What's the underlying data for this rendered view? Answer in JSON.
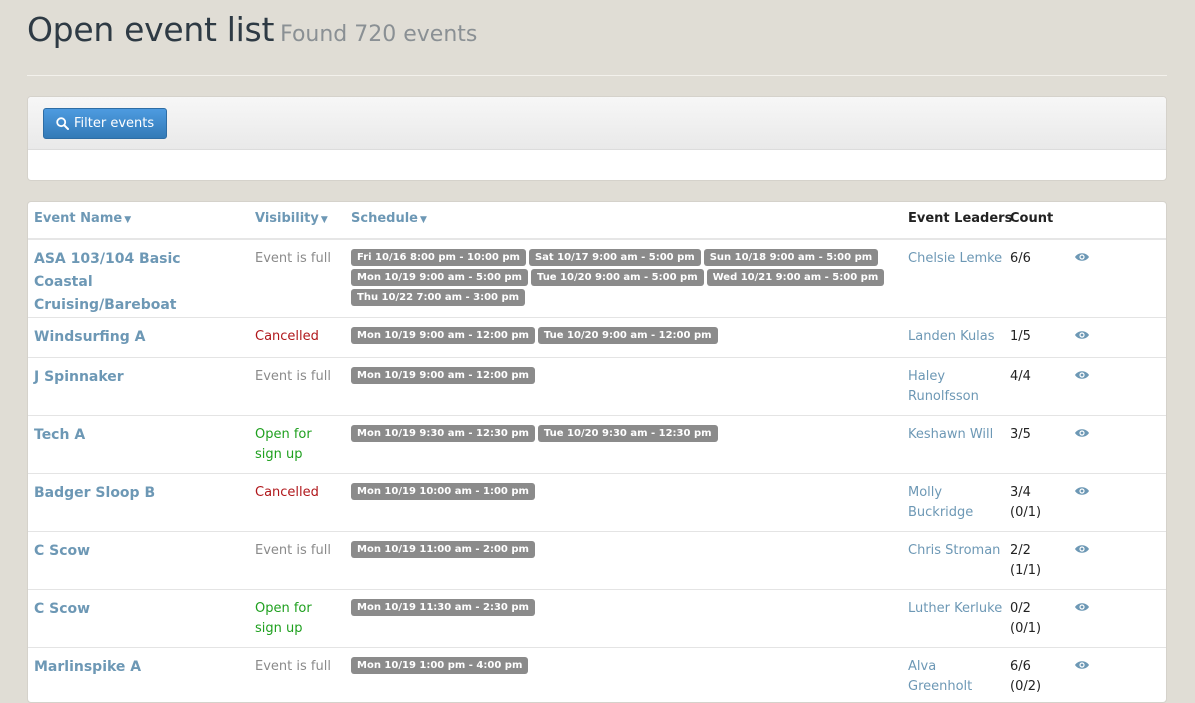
{
  "page": {
    "title": "Open event list",
    "subtitle": "Found 720 events"
  },
  "filter": {
    "button_label": "Filter events",
    "icon": "search-icon"
  },
  "table": {
    "columns": {
      "name": "Event Name",
      "visibility": "Visibility",
      "schedule": "Schedule",
      "leaders": "Event Leaders",
      "count": "Count"
    },
    "rows": [
      {
        "name": "ASA 103/104 Basic Coastal Cruising/Bareboat",
        "visibility": "Event is full",
        "status": "full",
        "schedule": [
          "Fri 10/16 8:00 pm - 10:00 pm",
          "Sat 10/17 9:00 am - 5:00 pm",
          "Sun 10/18 9:00 am - 5:00 pm",
          "Mon 10/19 9:00 am - 5:00 pm",
          "Tue 10/20 9:00 am - 5:00 pm",
          "Wed 10/21 9:00 am - 5:00 pm",
          "Thu 10/22 7:00 am - 3:00 pm"
        ],
        "leaders": "Chelsie Lemke",
        "count": "6/6"
      },
      {
        "name": "Windsurfing A",
        "visibility": "Cancelled",
        "status": "cancelled",
        "schedule": [
          "Mon 10/19 9:00 am - 12:00 pm",
          "Tue 10/20 9:00 am - 12:00 pm"
        ],
        "leaders": "Landen Kulas",
        "count": "1/5"
      },
      {
        "name": "J Spinnaker",
        "visibility": "Event is full",
        "status": "full",
        "schedule": [
          "Mon 10/19 9:00 am - 12:00 pm"
        ],
        "leaders": "Haley Runolfsson",
        "count": "4/4"
      },
      {
        "name": "Tech A",
        "visibility": "Open for sign up",
        "status": "open",
        "schedule": [
          "Mon 10/19 9:30 am - 12:30 pm",
          "Tue 10/20 9:30 am - 12:30 pm"
        ],
        "leaders": "Keshawn Will",
        "count": "3/5"
      },
      {
        "name": "Badger Sloop B",
        "visibility": "Cancelled",
        "status": "cancelled",
        "schedule": [
          "Mon 10/19 10:00 am - 1:00 pm"
        ],
        "leaders": "Molly Buckridge",
        "count": "3/4 (0/1)"
      },
      {
        "name": "C Scow",
        "visibility": "Event is full",
        "status": "full",
        "schedule": [
          "Mon 10/19 11:00 am - 2:00 pm"
        ],
        "leaders": "Chris Stroman",
        "count": "2/2 (1/1)"
      },
      {
        "name": "C Scow",
        "visibility": "Open for sign up",
        "status": "open",
        "schedule": [
          "Mon 10/19 11:30 am - 2:30 pm"
        ],
        "leaders": "Luther Kerluke",
        "count": "0/2 (0/1)"
      },
      {
        "name": "Marlinspike A",
        "visibility": "Event is full",
        "status": "full",
        "schedule": [
          "Mon 10/19 1:00 pm - 4:00 pm"
        ],
        "leaders": "Alva Greenholt",
        "count": "6/6 (0/2)"
      }
    ]
  },
  "colors": {
    "link": "#6d98b5",
    "full": "#8a8a8a",
    "cancelled": "#b0171b",
    "open": "#1fa01f",
    "badge": "#8b8b8b",
    "button": "#337ab7"
  }
}
